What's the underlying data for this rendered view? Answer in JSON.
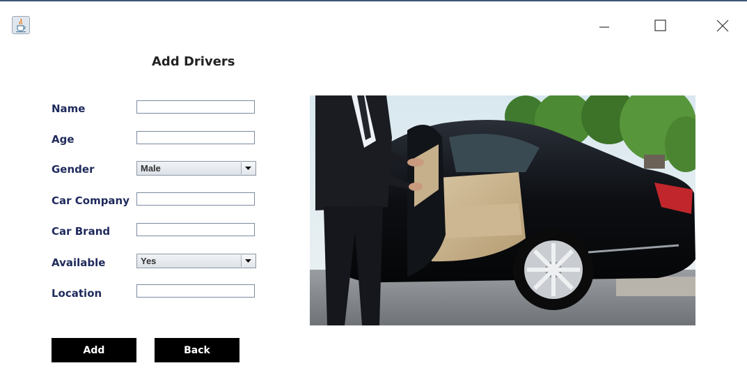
{
  "window": {
    "app_icon": "java-cup-icon",
    "controls": [
      "minimize-icon",
      "maximize-icon",
      "close-icon"
    ]
  },
  "form": {
    "title": "Add Drivers",
    "fields": {
      "name": {
        "label": "Name",
        "value": ""
      },
      "age": {
        "label": "Age",
        "value": ""
      },
      "gender": {
        "label": "Gender",
        "selected": "Male"
      },
      "car_company": {
        "label": "Car Company",
        "value": ""
      },
      "car_brand": {
        "label": "Car Brand",
        "value": ""
      },
      "available": {
        "label": "Available",
        "selected": "Yes"
      },
      "location": {
        "label": "Location",
        "value": ""
      }
    },
    "buttons": {
      "add": "Add",
      "back": "Back"
    }
  },
  "image": {
    "subject": "chauffeur-opening-car-door-photo"
  },
  "colors": {
    "label": "#1f2a5c",
    "button_bg": "#000000",
    "button_text": "#ffffff"
  }
}
